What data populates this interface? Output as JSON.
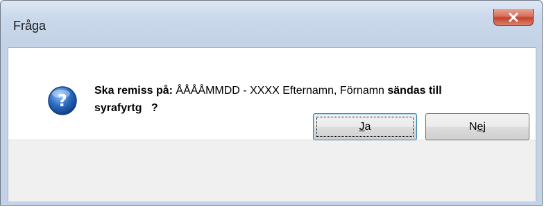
{
  "window": {
    "title": "Fråga"
  },
  "message": {
    "part1": "Ska remiss på: ",
    "part2": "ÅÅÅÅMMDD - XXXX Efternamn, Förnamn",
    "part3": " sändas till",
    "line2": "syrafyrtg   ?"
  },
  "buttons": {
    "yes": {
      "mnemonic": "J",
      "rest": "a"
    },
    "no": {
      "before": "N",
      "mnemonic": "e",
      "rest": "j"
    }
  },
  "icons": {
    "dialog_icon": "question-icon",
    "close": "close-icon"
  },
  "colors": {
    "close_button": "#c4432c",
    "icon_blue": "#2b6cc4"
  }
}
